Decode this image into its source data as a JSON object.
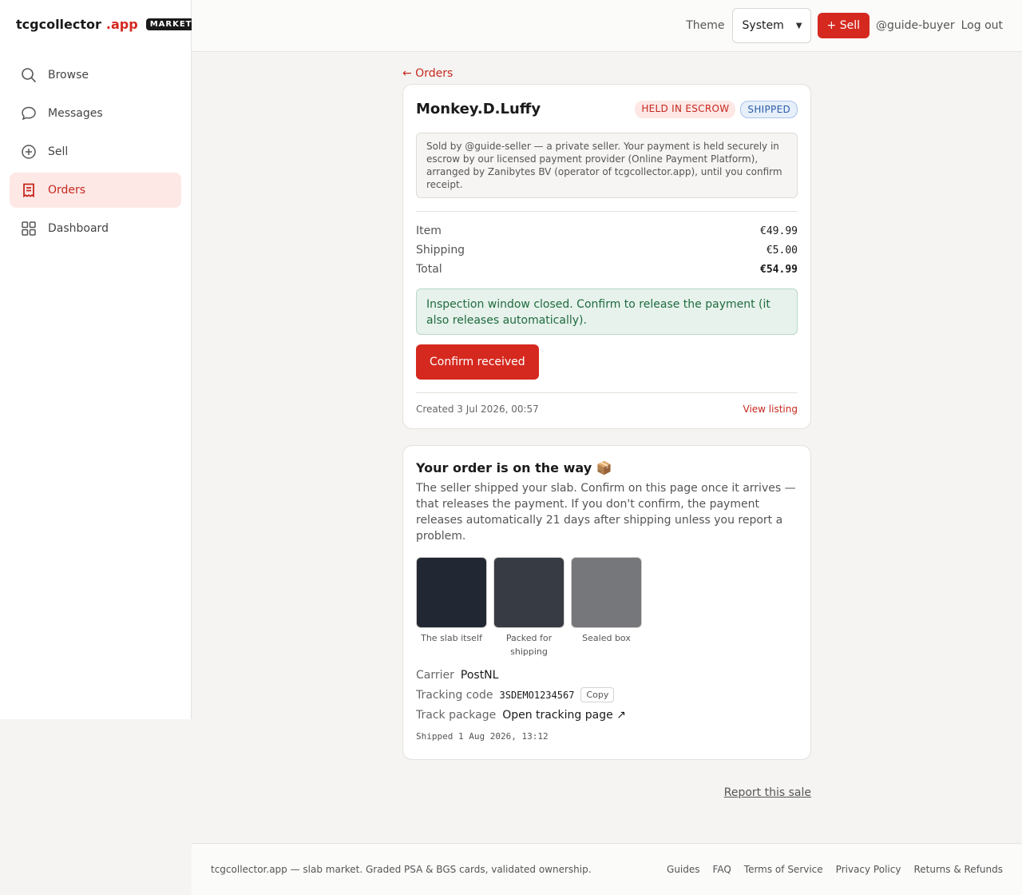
{
  "brand": {
    "name": "tcgcollector",
    "suffix": ".app",
    "badge": "MARKET"
  },
  "sidebar": {
    "items": [
      {
        "label": "Browse",
        "icon": "search-icon"
      },
      {
        "label": "Messages",
        "icon": "chat-bubble-icon"
      },
      {
        "label": "Sell",
        "icon": "plus-circle-icon"
      },
      {
        "label": "Orders",
        "icon": "receipt-icon",
        "active": true
      },
      {
        "label": "Dashboard",
        "icon": "grid-icon"
      }
    ]
  },
  "header": {
    "theme_label": "Theme",
    "theme_value": "System",
    "sell_label": "+ Sell",
    "user": "@guide-buyer",
    "logout": "Log out"
  },
  "order": {
    "back_label": "← Orders",
    "title": "Monkey.D.Luffy",
    "badges": {
      "escrow": "HELD IN ESCROW",
      "status": "SHIPPED"
    },
    "note": "Sold by @guide-seller — a private seller. Your payment is held securely in escrow by our licensed payment provider (Online Payment Platform), arranged by Zanibytes BV (operator of tcgcollector.app), until you confirm receipt.",
    "prices": {
      "item_label": "Item",
      "item_value": "€49.99",
      "shipping_label": "Shipping",
      "shipping_value": "€5.00",
      "total_label": "Total",
      "total_value": "€54.99"
    },
    "notice": "Inspection window closed. Confirm to release the payment (it also releases automatically).",
    "confirm_label": "Confirm received",
    "created": "Created 3 Jul 2026, 00:57",
    "view_listing": "View listing"
  },
  "shipping": {
    "title": "Your order is on the way 📦",
    "description": "The seller shipped your slab. Confirm on this page once it arrives — that releases the payment. If you don't confirm, the payment releases automatically 21 days after shipping unless you report a problem.",
    "photos": [
      {
        "caption": "The slab itself",
        "color": "#222833"
      },
      {
        "caption": "Packed for shipping",
        "color": "#373b43"
      },
      {
        "caption": "Sealed box",
        "color": "#76777a"
      }
    ],
    "carrier_label": "Carrier",
    "carrier_value": "PostNL",
    "tracking_label": "Tracking code",
    "tracking_value": "3SDEMO1234567",
    "copy_label": "Copy",
    "track_label": "Track package",
    "track_link": "Open tracking page ↗",
    "shipped_at": "Shipped 1 Aug 2026, 13:12"
  },
  "report_label": "Report this sale",
  "footer": {
    "text": "tcgcollector.app — slab market. Graded PSA & BGS cards, validated ownership.",
    "links": [
      "Guides",
      "FAQ",
      "Terms of Service",
      "Privacy Policy",
      "Returns & Refunds"
    ]
  },
  "colors": {
    "accent": "#d5291f",
    "success_bg": "#e7f2ec",
    "success_text": "#1e6b3d"
  }
}
